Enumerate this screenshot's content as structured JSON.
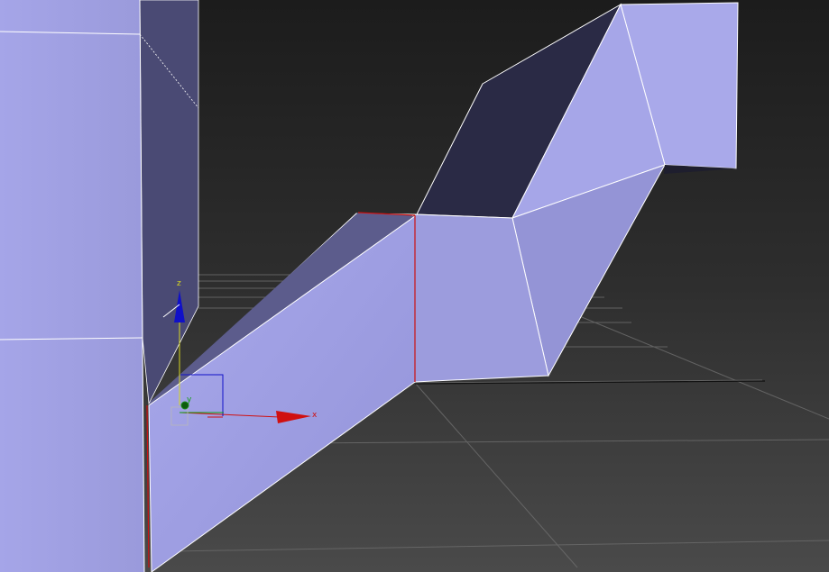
{
  "viewport": {
    "background_top": "#1e1e1e",
    "background_bottom": "#4a4a4a",
    "grid_color": "#6f6f6f"
  },
  "mesh": {
    "face_light": "#a7a7e6",
    "face_mid": "#9797d9",
    "face_shadow": "#5c5c8a",
    "face_dark": "#2a2a45",
    "edge_color": "#ffffff",
    "selected_edge_color": "#cc1111"
  },
  "gizmo": {
    "x_label": "x",
    "y_label": "y",
    "z_label": "z",
    "x_color": "#d01010",
    "y_color": "#10a010",
    "z_color": "#1010c8"
  }
}
